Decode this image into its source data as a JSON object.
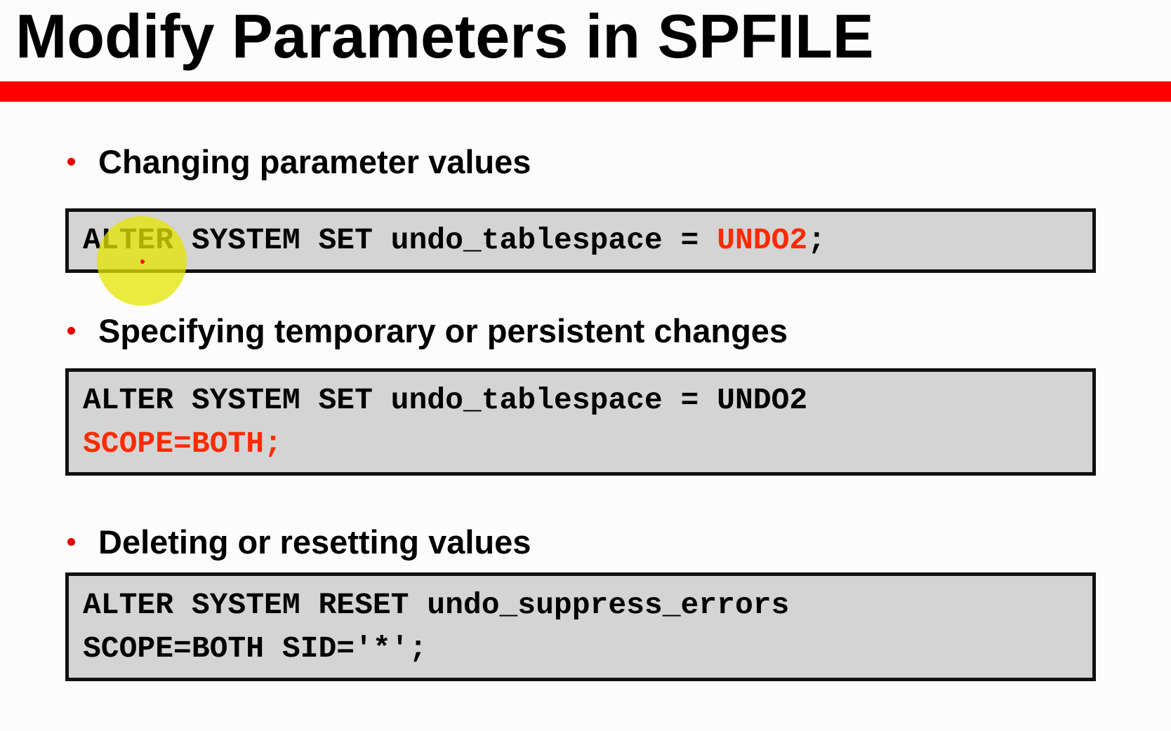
{
  "slide": {
    "title": "Modify Parameters in SPFILE",
    "sections": [
      {
        "bullet": "Changing parameter values",
        "code_lines": [
          {
            "plain": "ALTER SYSTEM SET undo_tablespace = ",
            "highlight": "UNDO2",
            "tail": ";"
          }
        ]
      },
      {
        "bullet": "Specifying temporary or persistent changes",
        "code_lines": [
          {
            "plain": "ALTER SYSTEM SET undo_tablespace = UNDO2",
            "highlight": "",
            "tail": ""
          },
          {
            "plain": "",
            "highlight": "SCOPE=BOTH;",
            "tail": ""
          }
        ]
      },
      {
        "bullet": "Deleting or resetting values",
        "code_lines": [
          {
            "plain": "ALTER SYSTEM RESET undo_suppress_errors",
            "highlight": "",
            "tail": ""
          },
          {
            "plain": "SCOPE=BOTH SID='*';",
            "highlight": "",
            "tail": ""
          }
        ]
      }
    ]
  },
  "colors": {
    "title_bar": "#ff0000",
    "bullet": "#e60000",
    "code_highlight": "#ff2a00",
    "code_background": "#d4d4d4",
    "cursor_highlight": "#e6e600"
  }
}
